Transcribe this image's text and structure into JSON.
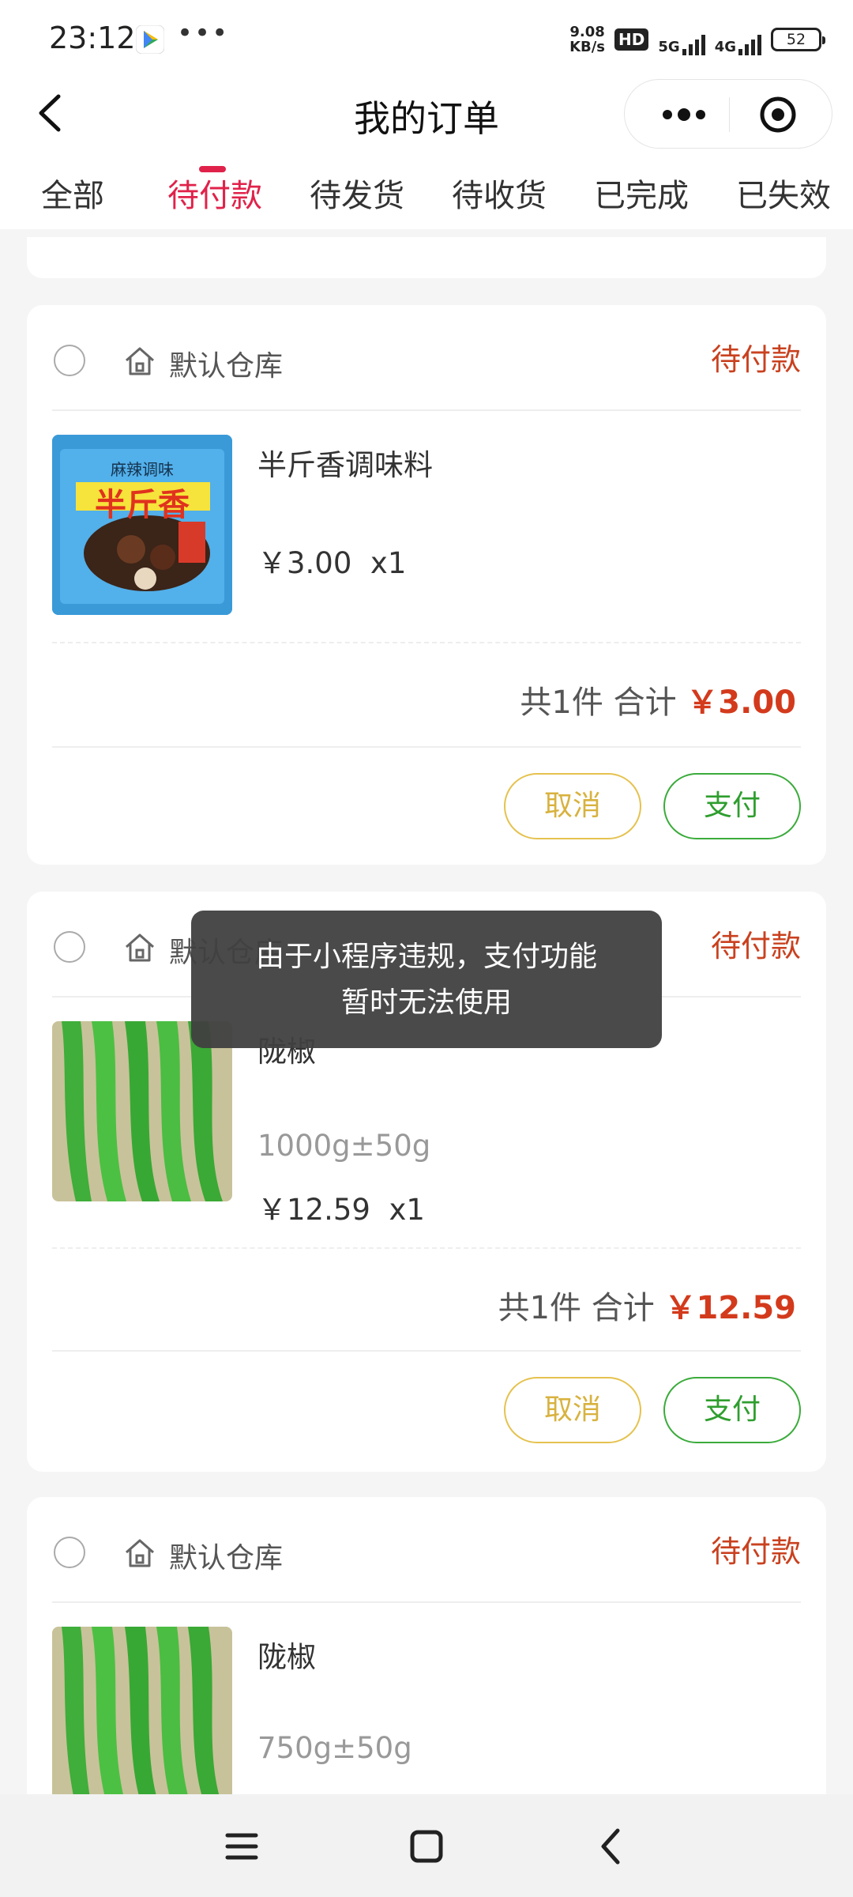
{
  "status_bar": {
    "time": "23:12",
    "speed_value": "9.08",
    "speed_unit": "KB/s",
    "hd_badge": "HD",
    "network_1": "5G",
    "network_2": "4G",
    "battery": "52"
  },
  "header": {
    "title": "我的订单"
  },
  "tabs": [
    "全部",
    "待付款",
    "待发货",
    "待收货",
    "已完成",
    "已失效"
  ],
  "active_tab": 1,
  "orders": [
    {
      "warehouse": "默认仓库",
      "status": "待付款",
      "product_name": "半斤香调味料",
      "spec": "",
      "price": "￥3.00",
      "qty": "x1",
      "count_label": "共1件",
      "total_label": "合计",
      "total": "￥3.00",
      "cancel_label": "取消",
      "pay_label": "支付",
      "package_text_top": "麻辣调味",
      "package_text_main": "半斤香"
    },
    {
      "warehouse": "默认仓库",
      "status": "待付款",
      "product_name": "陇椒",
      "spec": "1000g±50g",
      "price": "￥12.59",
      "qty": "x1",
      "count_label": "共1件",
      "total_label": "合计",
      "total": "￥12.59",
      "cancel_label": "取消",
      "pay_label": "支付"
    },
    {
      "warehouse": "默认仓库",
      "status": "待付款",
      "product_name": "陇椒",
      "spec": "750g±50g"
    }
  ],
  "toast": {
    "line1": "由于小程序违规，支付功能",
    "line2": "暂时无法使用"
  },
  "colors": {
    "accent": "#e0224a",
    "status": "#c9411f",
    "total": "#d33a1c",
    "cancel_border": "#e5c24f",
    "pay_border": "#3bab3b"
  }
}
